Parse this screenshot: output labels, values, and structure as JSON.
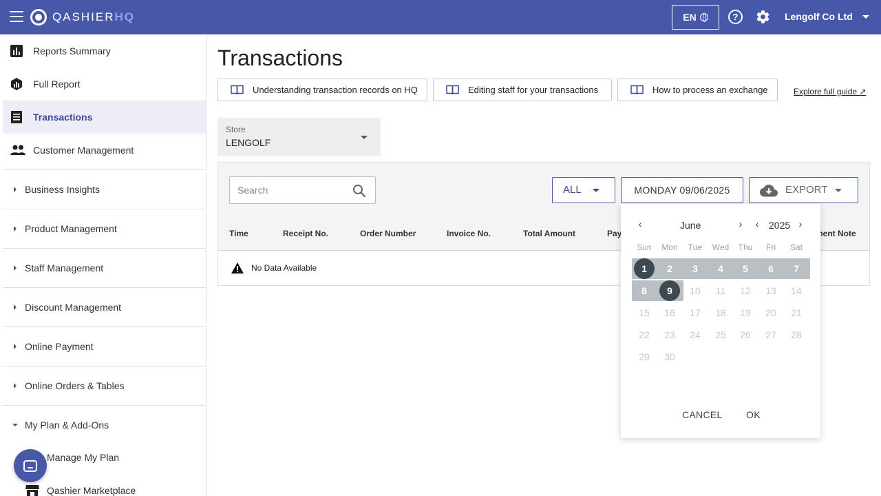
{
  "header": {
    "logo_text": "QASHIER",
    "logo_text_hq": "HQ",
    "language": "EN",
    "help_label": "?",
    "account_name": "Lengolf Co Ltd"
  },
  "sidebar": {
    "nav": [
      {
        "label": "Reports Summary",
        "icon": "bar-chart-icon"
      },
      {
        "label": "Full Report",
        "icon": "hexagon-chart-icon"
      },
      {
        "label": "Transactions",
        "icon": "receipt-icon",
        "active": true
      },
      {
        "label": "Customer Management",
        "icon": "people-icon"
      }
    ],
    "sections": [
      {
        "label": "Business Insights",
        "expanded": false
      },
      {
        "label": "Product Management",
        "expanded": false
      },
      {
        "label": "Staff Management",
        "expanded": false
      },
      {
        "label": "Discount Management",
        "expanded": false
      },
      {
        "label": "Online Payment",
        "expanded": false
      },
      {
        "label": "Online Orders & Tables",
        "expanded": false
      },
      {
        "label": "My Plan & Add-Ons",
        "expanded": true
      }
    ],
    "sub_items": [
      {
        "label": "Manage My Plan"
      },
      {
        "label": "Qashier Marketplace",
        "icon": "store-icon"
      }
    ]
  },
  "main": {
    "title": "Transactions",
    "guides": [
      {
        "label": "Understanding transaction records on HQ"
      },
      {
        "label": "Editing staff for your transactions"
      },
      {
        "label": "How to process an exchange"
      }
    ],
    "explore_link": "Explore full guide",
    "store": {
      "label": "Store",
      "value": "LENGOLF"
    },
    "search": {
      "placeholder": "Search",
      "value": ""
    },
    "filter": {
      "label": "ALL"
    },
    "date": {
      "value": "MONDAY 09/06/2025"
    },
    "export": {
      "label": "EXPORT"
    },
    "table": {
      "headers": [
        "Time",
        "Receipt No.",
        "Order Number",
        "Invoice No.",
        "Total Amount",
        "Pay",
        "ment Note"
      ],
      "empty_text": "No Data Available"
    }
  },
  "calendar": {
    "month": "June",
    "year": "2025",
    "weekdays": [
      "Sun",
      "Mon",
      "Tue",
      "Wed",
      "Thu",
      "Fri",
      "Sat"
    ],
    "weeks": [
      [
        "1",
        "2",
        "3",
        "4",
        "5",
        "6",
        "7"
      ],
      [
        "8",
        "9",
        "10",
        "11",
        "12",
        "13",
        "14"
      ],
      [
        "15",
        "16",
        "17",
        "18",
        "19",
        "20",
        "21"
      ],
      [
        "22",
        "23",
        "24",
        "25",
        "26",
        "27",
        "28"
      ],
      [
        "29",
        "30",
        "",
        "",
        "",
        "",
        ""
      ]
    ],
    "range_start": "1",
    "range_end": "9",
    "cancel_label": "CANCEL",
    "ok_label": "OK",
    "colors": {
      "band": "#b9bfc3",
      "selected": "#3d4a52"
    }
  },
  "colors": {
    "brand": "#4758a8",
    "active_bg": "#ecedf5"
  }
}
